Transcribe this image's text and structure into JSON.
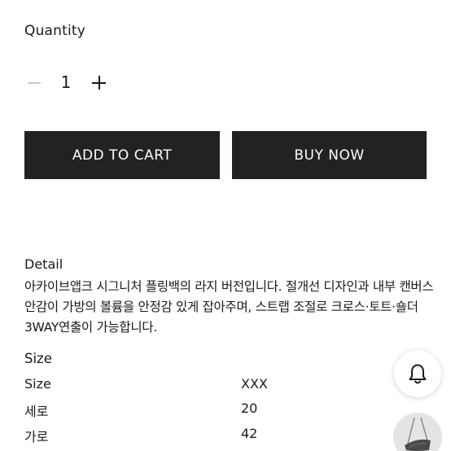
{
  "quantity": {
    "label": "Quantity",
    "value": "1"
  },
  "actions": {
    "add_to_cart": "ADD TO CART",
    "buy_now": "BUY NOW"
  },
  "detail": {
    "title": "Detail",
    "text": "아카이브앱크 시그니처 플링백의 라지 버전입니다. 절개선 디자인과 내부 캔버스 안감이 가방의 볼륨을 안정감 있게 잡아주며, 스트랩 조절로 크로스·토트·숄더 3WAY연출이 가능합니다."
  },
  "size": {
    "title": "Size",
    "rows": [
      {
        "key": "Size",
        "value": "XXX"
      },
      {
        "key": "세로",
        "value": "20"
      },
      {
        "key": "가로",
        "value": "42"
      }
    ]
  },
  "icons": {
    "notify": "bell-icon",
    "minus": "minus-icon",
    "plus": "plus-icon"
  },
  "colors": {
    "button_bg": "#222222",
    "button_text": "#ffffff",
    "minus_disabled": "#c8c8c8"
  }
}
